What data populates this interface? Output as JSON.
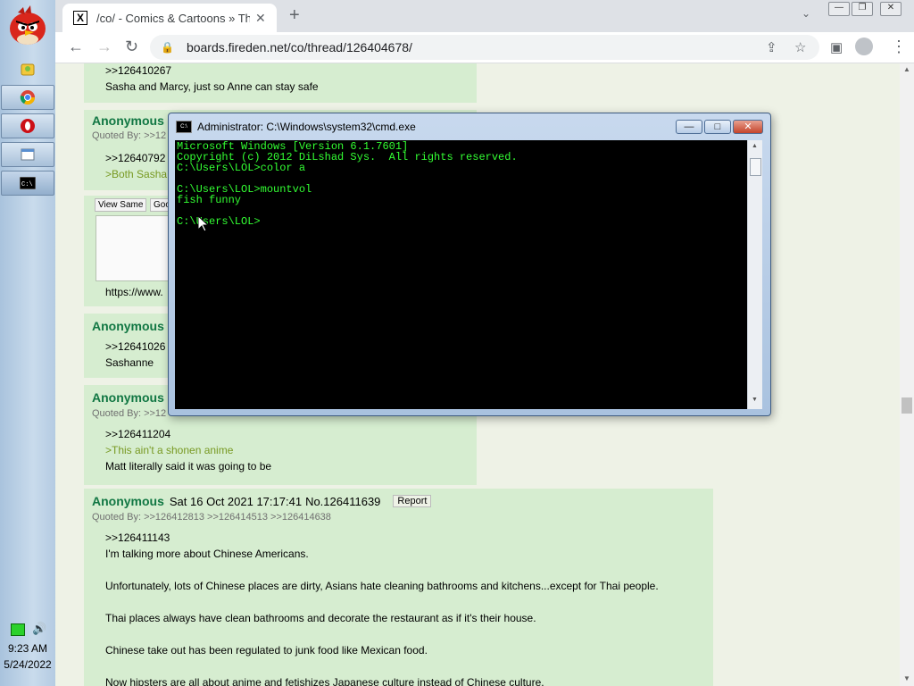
{
  "taskbar": {
    "clock_time": "9:23 AM",
    "clock_date": "5/24/2022",
    "buttons": [
      "explorer",
      "chrome",
      "opera",
      "window",
      "cmd"
    ]
  },
  "browser": {
    "tab_title": "/co/ - Comics & Cartoons » Thre",
    "tab_favicon": "X",
    "url": "boards.fireden.net/co/thread/126404678/"
  },
  "posts": {
    "p0": {
      "ref": ">>126410267",
      "text": "Sasha and Marcy, just so Anne can stay safe"
    },
    "p1": {
      "name": "Anonymous",
      "quoted": "Quoted By: >>12",
      "ref": ">>12640792",
      "greentext": ">Both Sasha"
    },
    "p2": {
      "view_same": "View Same",
      "google": "Goo",
      "link": "https://www."
    },
    "p3": {
      "name": "Anonymous",
      "ref": ">>12641026",
      "text": "Sashanne"
    },
    "p4": {
      "name": "Anonymous",
      "quoted": "Quoted By: >>12",
      "ref": ">>126411204",
      "greentext": ">This ain't a shonen anime",
      "text": "Matt literally said it was going to be"
    },
    "p5": {
      "name": "Anonymous",
      "date": "Sat 16 Oct 2021 17:17:41",
      "no": "No.126411639",
      "report": "Report",
      "quoted": "Quoted By: >>126412813 >>126414513 >>126414638",
      "ref": ">>126411143",
      "line1": "I'm talking more about Chinese Americans.",
      "line2": "Unfortunately, lots of Chinese places are dirty, Asians hate cleaning bathrooms and kitchens...except for Thai people.",
      "line3": "Thai places always have clean bathrooms and decorate the restaurant as if it's their house.",
      "line4": "Chinese take out has been regulated to junk food like Mexican food.",
      "line5": "Now hipsters are all about anime and fetishizes Japanese culture instead of Chinese culture."
    }
  },
  "cmd": {
    "title": "Administrator: C:\\Windows\\system32\\cmd.exe",
    "lines": [
      "Microsoft Windows [Version 6.1.7601]",
      "Copyright (c) 2012 DiLshad Sys.  All rights reserved.",
      "C:\\Users\\LOL>color a",
      "",
      "C:\\Users\\LOL>mountvol",
      "fish funny",
      "",
      "C:\\Users\\LOL>"
    ],
    "text_color": "#33ff33"
  }
}
